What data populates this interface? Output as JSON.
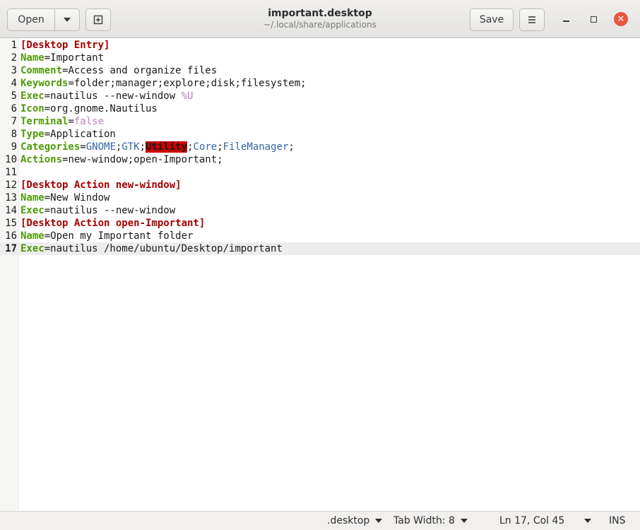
{
  "header": {
    "open_label": "Open",
    "save_label": "Save",
    "title": "important.desktop",
    "subtitle": "~/.local/share/applications"
  },
  "editor": {
    "current_line": 17,
    "lines": [
      {
        "n": "1",
        "tokens": [
          {
            "t": "[Desktop Entry]",
            "c": "sec"
          }
        ]
      },
      {
        "n": "2",
        "tokens": [
          {
            "t": "Name",
            "c": "key"
          },
          {
            "t": "=Important",
            "c": "val"
          }
        ]
      },
      {
        "n": "3",
        "tokens": [
          {
            "t": "Comment",
            "c": "key"
          },
          {
            "t": "=Access and organize files",
            "c": "val"
          }
        ]
      },
      {
        "n": "4",
        "tokens": [
          {
            "t": "Keywords",
            "c": "key"
          },
          {
            "t": "=folder;manager;explore;disk;filesystem;",
            "c": "val"
          }
        ]
      },
      {
        "n": "5",
        "tokens": [
          {
            "t": "Exec",
            "c": "key"
          },
          {
            "t": "=nautilus --new-window ",
            "c": "val"
          },
          {
            "t": "%U",
            "c": "lit"
          }
        ]
      },
      {
        "n": "6",
        "tokens": [
          {
            "t": "Icon",
            "c": "key"
          },
          {
            "t": "=org.gnome.Nautilus",
            "c": "val"
          }
        ]
      },
      {
        "n": "7",
        "tokens": [
          {
            "t": "Terminal",
            "c": "key"
          },
          {
            "t": "=",
            "c": "val"
          },
          {
            "t": "false",
            "c": "lit"
          }
        ]
      },
      {
        "n": "8",
        "tokens": [
          {
            "t": "Type",
            "c": "key"
          },
          {
            "t": "=Application",
            "c": "val"
          }
        ]
      },
      {
        "n": "9",
        "tokens": [
          {
            "t": "Categories",
            "c": "key"
          },
          {
            "t": "=",
            "c": "val"
          },
          {
            "t": "GNOME",
            "c": "enum"
          },
          {
            "t": ";",
            "c": "val"
          },
          {
            "t": "GTK",
            "c": "enum"
          },
          {
            "t": ";",
            "c": "val"
          },
          {
            "t": "Utility",
            "c": "err"
          },
          {
            "t": ";",
            "c": "val"
          },
          {
            "t": "Core",
            "c": "enum"
          },
          {
            "t": ";",
            "c": "val"
          },
          {
            "t": "FileManager",
            "c": "enum"
          },
          {
            "t": ";",
            "c": "val"
          }
        ]
      },
      {
        "n": "10",
        "tokens": [
          {
            "t": "Actions",
            "c": "key"
          },
          {
            "t": "=new-window;open-Important;",
            "c": "val"
          }
        ]
      },
      {
        "n": "11",
        "tokens": []
      },
      {
        "n": "12",
        "tokens": [
          {
            "t": "[Desktop Action new-window]",
            "c": "sec"
          }
        ]
      },
      {
        "n": "13",
        "tokens": [
          {
            "t": "Name",
            "c": "key"
          },
          {
            "t": "=New Window",
            "c": "val"
          }
        ]
      },
      {
        "n": "14",
        "tokens": [
          {
            "t": "Exec",
            "c": "key"
          },
          {
            "t": "=nautilus --new-window",
            "c": "val"
          }
        ]
      },
      {
        "n": "15",
        "tokens": [
          {
            "t": "[Desktop Action open-Important]",
            "c": "sec"
          }
        ]
      },
      {
        "n": "16",
        "tokens": [
          {
            "t": "Name",
            "c": "key"
          },
          {
            "t": "=Open my Important folder",
            "c": "val"
          }
        ]
      },
      {
        "n": "17",
        "tokens": [
          {
            "t": "Exec",
            "c": "key"
          },
          {
            "t": "=nautilus /home/ubuntu/Desktop/important",
            "c": "val"
          }
        ]
      }
    ]
  },
  "status": {
    "language": ".desktop",
    "tab_width": "Tab Width: 8",
    "position": "Ln 17, Col 45",
    "mode": "INS"
  },
  "colors": {
    "section": "#a40000",
    "key": "#4e9a06",
    "literal": "#c07fc0",
    "category": "#3465a4",
    "error_bg": "#cc0000",
    "close_button": "#e9573f"
  }
}
